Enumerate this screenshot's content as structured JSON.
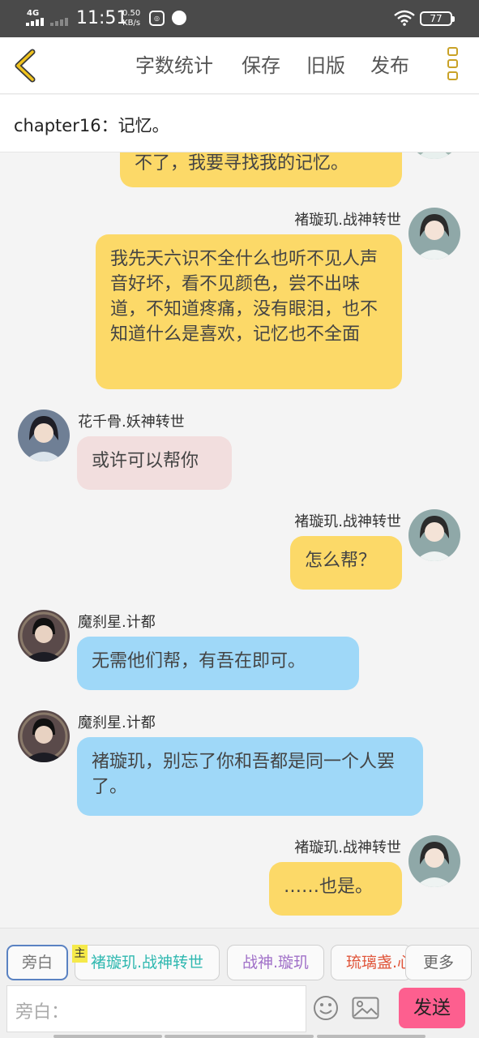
{
  "status_bar": {
    "network": "4G",
    "time": "11:51",
    "speed_value": "0.50",
    "speed_unit": "KB/s",
    "battery": "77",
    "colors": {
      "background": "#4a4a4a"
    }
  },
  "toolbar": {
    "back_icon": "chevron-left-icon",
    "items": [
      "字数统计",
      "保存",
      "旧版",
      "发布"
    ],
    "more_icon": "more-vertical-icon",
    "accent": "#f0c31e"
  },
  "chapter": {
    "title": "chapter16：记忆。"
  },
  "messages": [
    {
      "side": "right",
      "text": "不了，我要寻找我的记忆。"
    },
    {
      "side": "right",
      "name": "褚璇玑.战神转世",
      "text": "我先天六识不全什么也听不见人声音好坏，看不见颜色，尝不出味道，不知道疼痛，没有眼泪，也不知道什么是喜欢，记忆也不全面"
    },
    {
      "side": "left",
      "name": "花千骨.妖神转世",
      "text": "或许可以帮你"
    },
    {
      "side": "right",
      "name": "褚璇玑.战神转世",
      "text": "怎么帮？"
    },
    {
      "side": "left",
      "name": "魔刹星.计都",
      "text": "无需他们帮，有吾在即可。"
    },
    {
      "side": "left",
      "name": "魔刹星.计都",
      "text": "褚璇玑，别忘了你和吾都是同一个人罢了。"
    },
    {
      "side": "right",
      "name": "褚璇玑.战神转世",
      "text": "……也是。"
    }
  ],
  "bubble_colors": {
    "protagonist": "#fcd968",
    "huaqiangu": "#f2dede",
    "jidu": "#9fd8f8"
  },
  "roles": {
    "main_tag": "主",
    "items": [
      {
        "label": "旁白",
        "color": "#777777"
      },
      {
        "label": "褚璇玑.战神转世",
        "color": "#2fb8b0"
      },
      {
        "label": "战神.璇玑",
        "color": "#a070c8"
      },
      {
        "label": "琉璃盏.心",
        "color": "#e0553a"
      }
    ],
    "more": "更多"
  },
  "composer": {
    "placeholder": "旁白：",
    "send": "发送",
    "emoji_icon": "smiley-icon",
    "image_icon": "image-icon"
  }
}
